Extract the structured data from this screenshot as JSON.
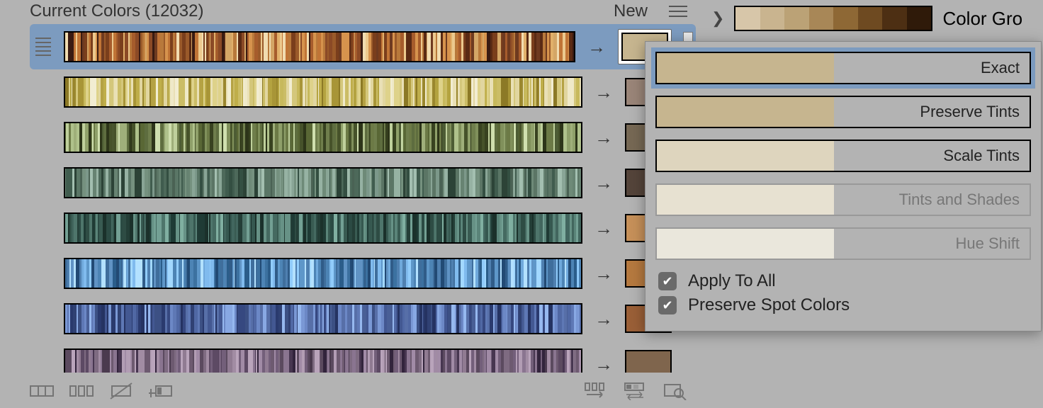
{
  "header": {
    "title_prefix": "Current Colors",
    "count": 12032,
    "new_label": "New"
  },
  "rows": [
    {
      "target": "#c6b58f",
      "selected": true,
      "palette": [
        "#3a1b12",
        "#6e3a20",
        "#8b4a26",
        "#a65c2c",
        "#c07436",
        "#d6934d",
        "#e1b06a",
        "#ecc98e",
        "#f1dcb0",
        "#d4a666",
        "#b8793b",
        "#9a5a2a",
        "#7a3e1c",
        "#5a2a14"
      ]
    },
    {
      "target": "#9a8578",
      "selected": false,
      "palette": [
        "#efe9c8",
        "#e1d6a0",
        "#d4c77b",
        "#c7b95c",
        "#bfae4a",
        "#b4a340",
        "#a89537",
        "#9a872e",
        "#8c7926",
        "#e9e0b6",
        "#f2edd2",
        "#ded28a",
        "#cbbd66",
        "#b5a244"
      ]
    },
    {
      "target": "#766854",
      "selected": false,
      "palette": [
        "#4d5c34",
        "#5e6d3f",
        "#6f7e4c",
        "#80905b",
        "#8fa06a",
        "#9faf7a",
        "#afc18b",
        "#bfd09c",
        "#cfdfae",
        "#6c7a46",
        "#596735",
        "#46522a",
        "#384220",
        "#2d3519"
      ]
    },
    {
      "target": "#54443a",
      "selected": false,
      "palette": [
        "#75917f",
        "#678372",
        "#5a7666",
        "#4d695a",
        "#405c4e",
        "#344f42",
        "#2c4337",
        "#6e8a78",
        "#7c988a",
        "#89a596",
        "#96b2a3",
        "#a3bfb0",
        "#5b7565",
        "#4a6254"
      ]
    },
    {
      "target": "#c69059",
      "selected": false,
      "palette": [
        "#1f3b35",
        "#2b4a43",
        "#365850",
        "#42665e",
        "#4e756b",
        "#5a8479",
        "#679286",
        "#73a094",
        "#80afa1",
        "#456a61",
        "#395b52",
        "#2e4c44",
        "#243e37",
        "#1b312b"
      ]
    },
    {
      "target": "#b5793f",
      "selected": false,
      "palette": [
        "#2b5d8a",
        "#3c71a0",
        "#4d84b5",
        "#5e97c9",
        "#6fa9dc",
        "#80bbee",
        "#91ccfb",
        "#a2d8ff",
        "#b3e1ff",
        "#6093c4",
        "#4f80b0",
        "#3f6e9c",
        "#305c88",
        "#224a74"
      ]
    },
    {
      "target": "#9a5f37",
      "selected": false,
      "palette": [
        "#2a3a6e",
        "#364880",
        "#435892",
        "#5068a4",
        "#5e78b5",
        "#6c88c6",
        "#7a98d5",
        "#88a8e3",
        "#96b8ef",
        "#576fa8",
        "#495f96",
        "#3c5084",
        "#304173",
        "#253362"
      ]
    },
    {
      "target": "#7f654d",
      "selected": false,
      "palette": [
        "#4a3a4e",
        "#5b4a5f",
        "#6d5a70",
        "#7e6b81",
        "#907b92",
        "#a18ca3",
        "#b29db4",
        "#b9a4bb",
        "#a18ba6",
        "#8a7590",
        "#735f7a",
        "#5d4a64",
        "#473650",
        "#32243c"
      ]
    }
  ],
  "options": [
    {
      "label": "Exact",
      "swatch": "#c6b58f",
      "selected": true,
      "disabled": false
    },
    {
      "label": "Preserve Tints",
      "swatch": "#c6b58f",
      "selected": false,
      "disabled": false
    },
    {
      "label": "Scale Tints",
      "swatch": "#ded5be",
      "selected": false,
      "disabled": false
    },
    {
      "label": "Tints and Shades",
      "swatch": "#ece6d4",
      "selected": false,
      "disabled": true
    },
    {
      "label": "Hue Shift",
      "swatch": "#efece0",
      "selected": false,
      "disabled": true
    }
  ],
  "checks": {
    "apply_all": "Apply To All",
    "preserve_spot": "Preserve Spot Colors"
  },
  "right": {
    "group_label": "Color Gro",
    "group_palette": [
      "#d7c6a9",
      "#c9b48f",
      "#bba276",
      "#a88757",
      "#8e6835",
      "#6e4a21",
      "#4d2f13",
      "#2f1a09"
    ]
  }
}
